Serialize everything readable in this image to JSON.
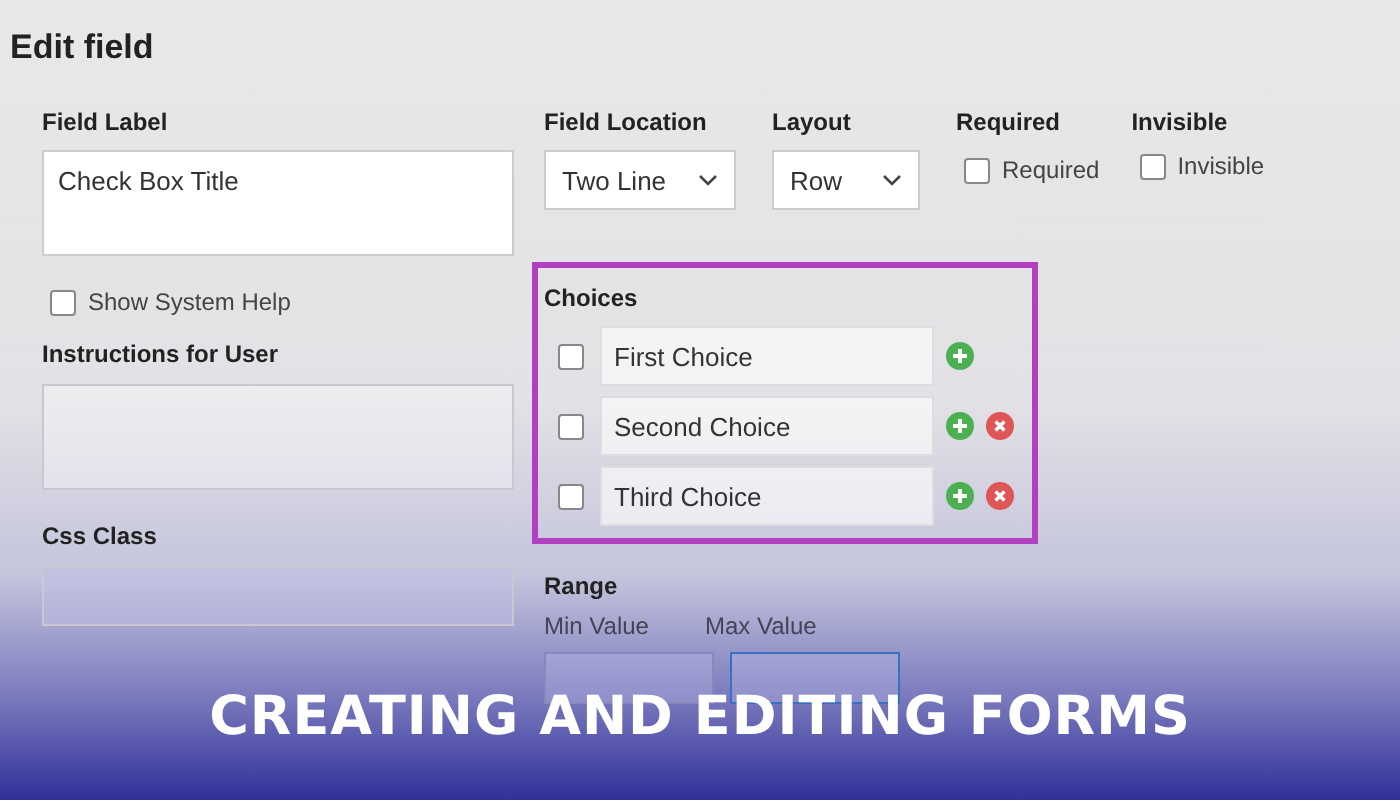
{
  "window": {
    "title": "Edit field"
  },
  "field_label": {
    "label": "Field Label",
    "value": "Check Box Title"
  },
  "show_system_help": {
    "label": "Show System Help",
    "checked": false
  },
  "instructions": {
    "label": "Instructions for User"
  },
  "css_class": {
    "label": "Css Class"
  },
  "field_location": {
    "label": "Field Location",
    "value": "Two Line"
  },
  "layout": {
    "label": "Layout",
    "value": "Row"
  },
  "required": {
    "heading": "Required",
    "label": "Required",
    "checked": false
  },
  "invisible": {
    "heading": "Invisible",
    "label": "Invisible",
    "checked": false
  },
  "choices": {
    "title": "Choices",
    "items": [
      {
        "value": "First Choice",
        "checked": false,
        "removable": false
      },
      {
        "value": "Second Choice",
        "checked": false,
        "removable": true
      },
      {
        "value": "Third Choice",
        "checked": false,
        "removable": true
      }
    ]
  },
  "range": {
    "title": "Range",
    "min_label": "Min Value",
    "max_label": "Max Value"
  },
  "caption": "CREATING AND EDITING FORMS"
}
